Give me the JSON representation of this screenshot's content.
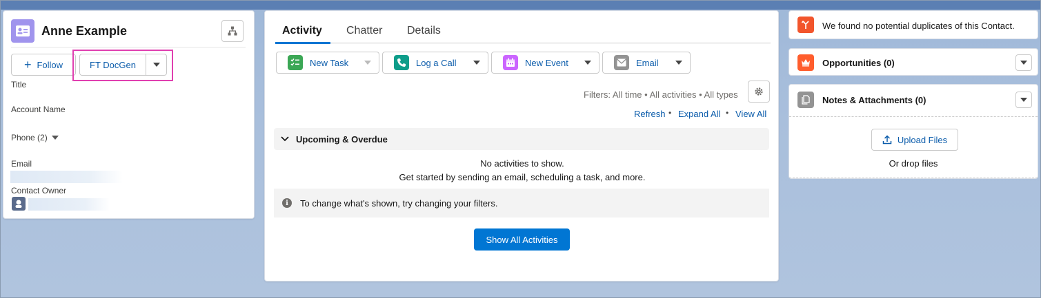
{
  "contact": {
    "name": "Anne Example",
    "follow_label": "Follow",
    "docgen_label": "FT DocGen",
    "fields": {
      "title": "Title",
      "account_name": "Account Name",
      "phone": "Phone (2)",
      "email": "Email",
      "contact_owner": "Contact Owner"
    }
  },
  "activity": {
    "tabs": [
      "Activity",
      "Chatter",
      "Details"
    ],
    "actions": {
      "new_task": "New Task",
      "log_call": "Log a Call",
      "new_event": "New Event",
      "email": "Email"
    },
    "filters": "Filters: All time • All activities • All types",
    "links": {
      "refresh": "Refresh",
      "expand_all": "Expand All",
      "view_all": "View All"
    },
    "section_title": "Upcoming & Overdue",
    "empty_title": "No activities to show.",
    "empty_subtitle": "Get started by sending an email, scheduling a task, and more.",
    "info_text": "To change what's shown, try changing your filters.",
    "show_all": "Show All Activities"
  },
  "related": {
    "duplicates": "We found no potential duplicates of this Contact.",
    "opportunities": "Opportunities (0)",
    "notes": "Notes & Attachments (0)",
    "upload": "Upload Files",
    "drop": "Or drop files"
  },
  "colors": {
    "brand": "#0176d3",
    "highlight": "#e040b0",
    "contact_icon": "#a094ed",
    "task_icon": "#3ba755",
    "call_icon": "#0e9d8a",
    "event_icon": "#cb65ff",
    "email_icon": "#939393",
    "dup_icon": "#f2552c",
    "opp_icon": "#ff5d2d",
    "notes_icon": "#939393"
  }
}
